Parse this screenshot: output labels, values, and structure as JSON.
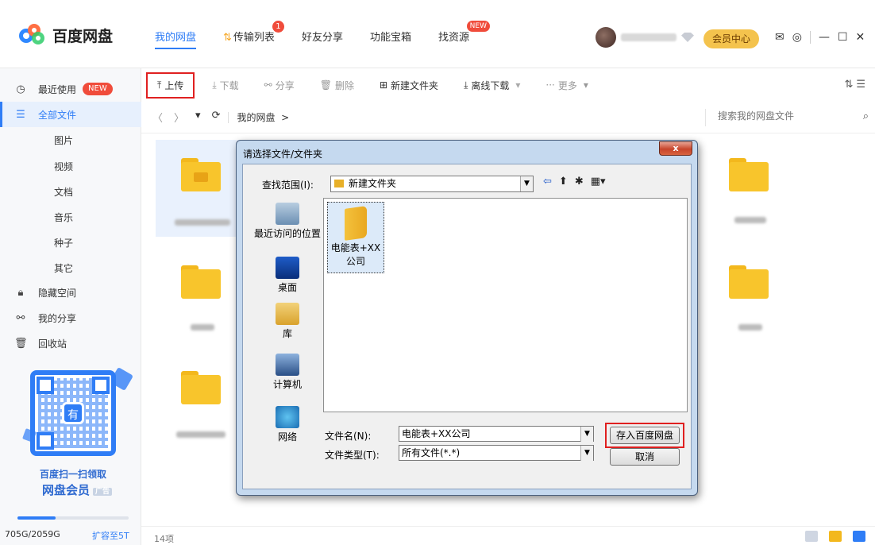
{
  "app": {
    "title": "百度网盘"
  },
  "nav": {
    "items": [
      {
        "label": "我的网盘"
      },
      {
        "label": "传输列表",
        "badge": "1"
      },
      {
        "label": "好友分享"
      },
      {
        "label": "功能宝箱"
      },
      {
        "label": "找资源",
        "badge": "NEW"
      }
    ],
    "vip_center": "会员中心"
  },
  "sidebar": {
    "recent": "最近使用",
    "recent_badge": "NEW",
    "all_files": "全部文件",
    "categories": [
      "图片",
      "视频",
      "文档",
      "音乐",
      "种子",
      "其它"
    ],
    "hidden_space": "隐藏空间",
    "my_share": "我的分享",
    "recycle_bin": "回收站",
    "promo_line1": "百度扫一扫领取",
    "promo_line2": "网盘会员",
    "ad_tag": "广告",
    "qr_center": "有",
    "quota_text": "705G/2059G",
    "quota_fraction": 0.342,
    "expand_link": "扩容至5T"
  },
  "toolbar": {
    "upload": "上传",
    "download": "下载",
    "share": "分享",
    "delete": "删除",
    "new_folder": "新建文件夹",
    "offline_download": "离线下载",
    "more": "更多"
  },
  "pathbar": {
    "crumb": "我的网盘",
    "crumb_arrow": ">",
    "search_placeholder": "搜索我的网盘文件"
  },
  "status": {
    "count": "14项"
  },
  "dialog": {
    "title": "请选择文件/文件夹",
    "close": "x",
    "look_in_label": "查找范围(I):",
    "look_in_value": "新建文件夹",
    "places": [
      "最近访问的位置",
      "桌面",
      "库",
      "计算机",
      "网络"
    ],
    "file_item": "电能表+XX公司",
    "filename_label": "文件名(N):",
    "filename_value": "电能表+XX公司",
    "filetype_label": "文件类型(T):",
    "filetype_value": "所有文件(*.*)",
    "save_button": "存入百度网盘",
    "cancel_button": "取消"
  },
  "colors": {
    "accent": "#2f7df6",
    "highlight_border": "#e02020",
    "folder": "#f8c52c",
    "vip": "#f4c34d"
  }
}
